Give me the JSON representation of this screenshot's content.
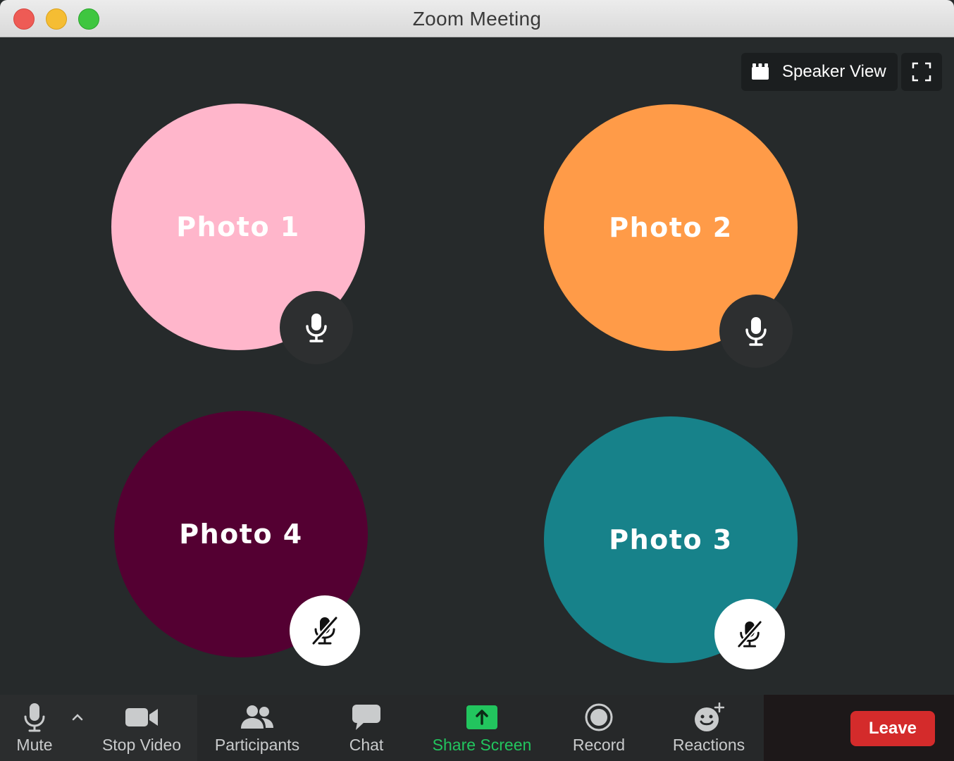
{
  "window": {
    "title": "Zoom Meeting"
  },
  "view_controls": {
    "view_label": "Speaker View"
  },
  "participants": [
    {
      "label": "Photo 1",
      "color": "#ffb6cb",
      "mic": "unmuted"
    },
    {
      "label": "Photo 2",
      "color": "#ff9b48",
      "mic": "unmuted"
    },
    {
      "label": "Photo 4",
      "color": "#540032",
      "mic": "muted"
    },
    {
      "label": "Photo 3",
      "color": "#17828a",
      "mic": "muted"
    }
  ],
  "toolbar": {
    "mute": "Mute",
    "stop_video": "Stop Video",
    "participants": "Participants",
    "chat": "Chat",
    "share_screen": "Share Screen",
    "record": "Record",
    "reactions": "Reactions",
    "leave": "Leave"
  },
  "colors": {
    "share_accent": "#22c55e",
    "leave": "#d42b2b",
    "background": "#262a2b"
  },
  "icons": {
    "traffic_lights": [
      "close-icon",
      "minimize-icon",
      "zoom-icon"
    ],
    "view": "grid-view-icon",
    "fullscreen": "fullscreen-icon",
    "mic_on": "microphone-icon",
    "mic_off": "microphone-muted-icon"
  }
}
